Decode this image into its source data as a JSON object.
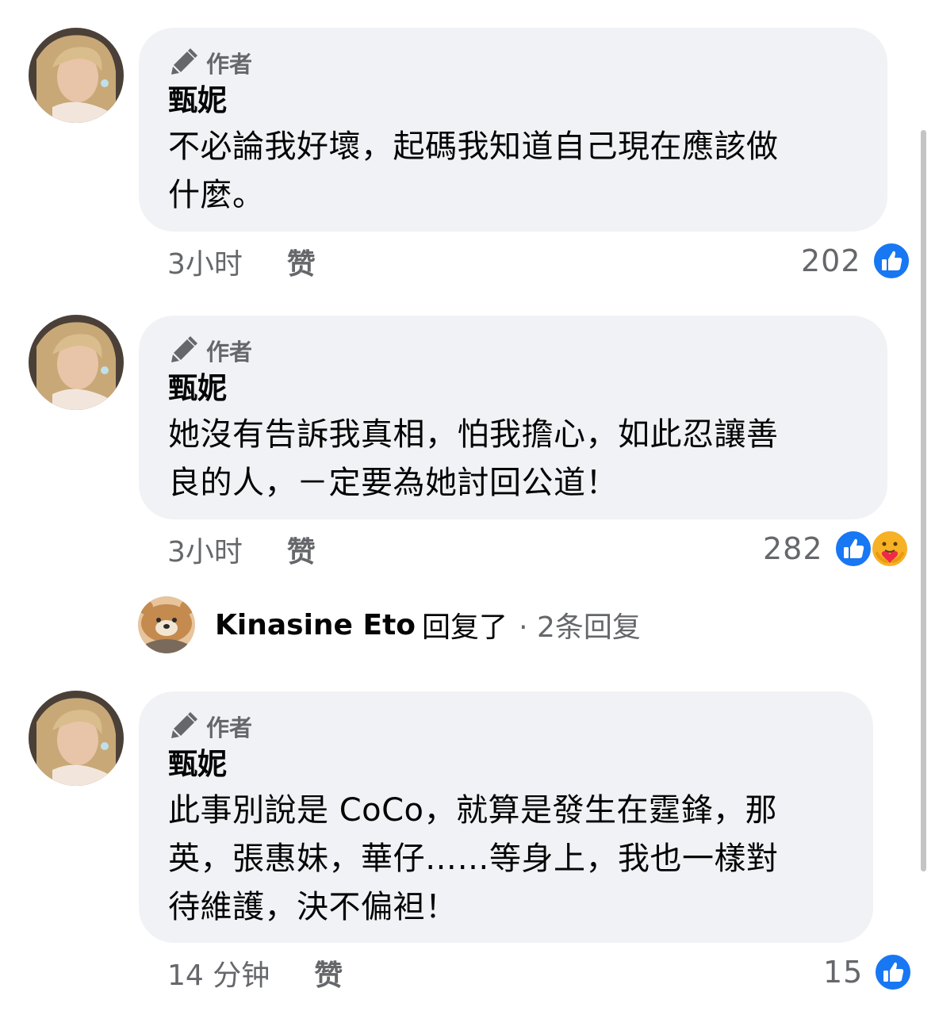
{
  "comments": [
    {
      "badge": "作者",
      "author": "甄妮",
      "text_lines": [
        "不必論我好壞，起碼我知道自己現在應該做",
        "什麼。"
      ],
      "time": "3小时",
      "like_label": "赞",
      "reaction_count": "202",
      "reactions": [
        "like-icon"
      ]
    },
    {
      "badge": "作者",
      "author": "甄妮",
      "text_lines": [
        "她沒有告訴我真相，怕我擔心，如此忍讓善",
        "良的人，－定要為她討回公道！"
      ],
      "time": "3小时",
      "like_label": "赞",
      "reaction_count": "282",
      "reactions": [
        "like-icon",
        "care-icon"
      ]
    },
    {
      "badge": "作者",
      "author": "甄妮",
      "text_lines": [
        "此事別說是 CoCo，就算是發生在霆鋒，那",
        "英，張惠妹，華仔……等身上，我也一樣對",
        "待維護，決不偏袒！"
      ],
      "time": "14 分钟",
      "like_label": "赞",
      "reaction_count": "15",
      "reactions": [
        "like-icon"
      ]
    }
  ],
  "reply_summary": {
    "name": "Kinasine Eto",
    "verb": "回复了",
    "count": "· 2条回复"
  },
  "colors": {
    "bubble": "#f0f2f5",
    "secondary_text": "#65676b",
    "like_blue": "#1877f2"
  }
}
